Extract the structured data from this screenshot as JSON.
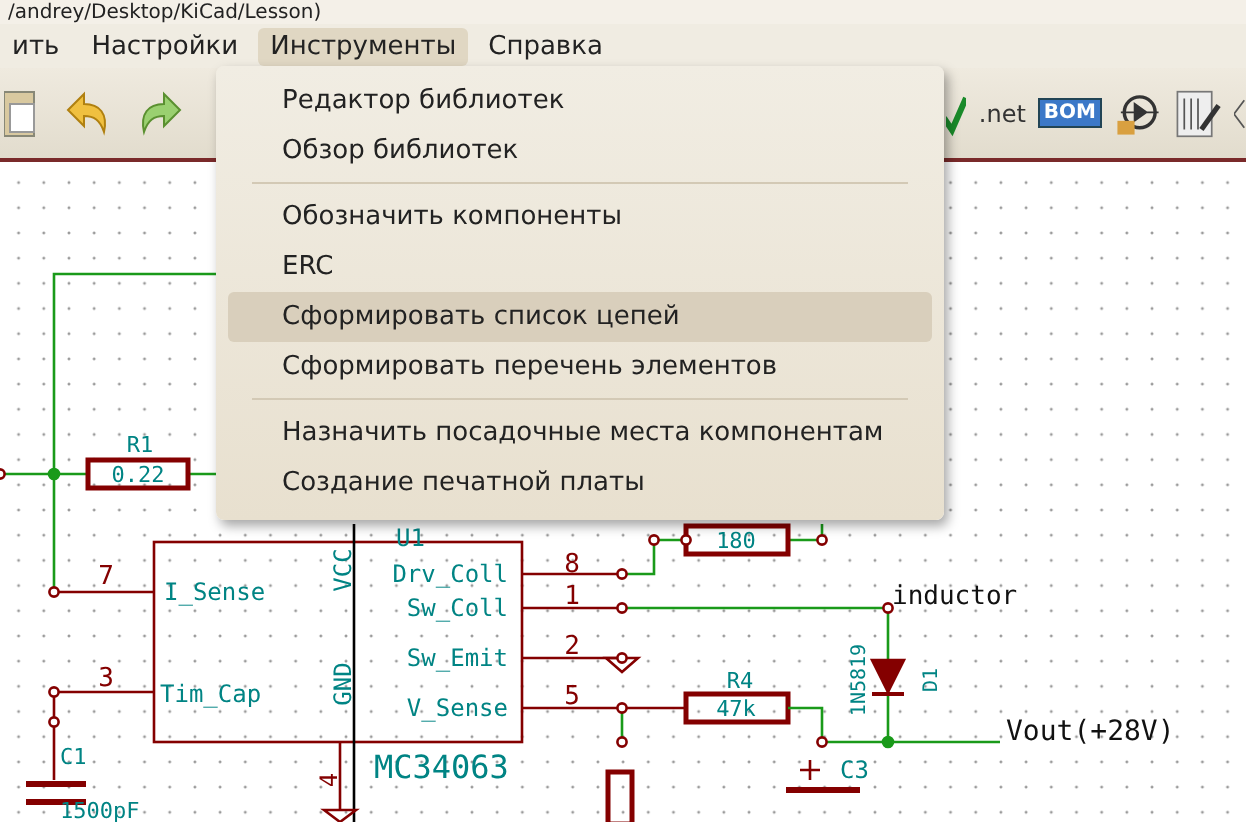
{
  "window": {
    "title": "/andrey/Desktop/KiCad/Lesson)"
  },
  "menubar": [
    {
      "label": "ить",
      "selected": false
    },
    {
      "label": "Настройки",
      "selected": false
    },
    {
      "label": "Инструменты",
      "selected": true
    },
    {
      "label": "Справка",
      "selected": false
    }
  ],
  "toolbar": {
    "netlist_label": ".net",
    "bom_label": "BOM"
  },
  "menu": {
    "items": [
      {
        "kind": "item",
        "label": "Редактор библиотек",
        "selected": false
      },
      {
        "kind": "item",
        "label": "Обзор библиотек",
        "selected": false
      },
      {
        "kind": "separator"
      },
      {
        "kind": "item",
        "label": "Обозначить компоненты",
        "selected": false
      },
      {
        "kind": "item",
        "label": "ERC",
        "selected": false
      },
      {
        "kind": "item",
        "label": "Сформировать список цепей",
        "selected": true
      },
      {
        "kind": "item",
        "label": "Сформировать перечень элементов",
        "selected": false
      },
      {
        "kind": "separator"
      },
      {
        "kind": "item",
        "label": "Назначить посадочные места компонентам",
        "selected": false
      },
      {
        "kind": "item",
        "label": "Создание печатной платы",
        "selected": false
      }
    ]
  },
  "schematic": {
    "labels": [
      {
        "kind": "reference",
        "text": "R1"
      },
      {
        "kind": "value",
        "text": "0.22"
      },
      {
        "kind": "reference",
        "text": "U1"
      },
      {
        "kind": "pin_name",
        "text": "I_Sense"
      },
      {
        "kind": "pin_name",
        "text": "Tim_Cap"
      },
      {
        "kind": "pin_name",
        "text": "VCC"
      },
      {
        "kind": "pin_name",
        "text": "GND"
      },
      {
        "kind": "pin_name",
        "text": "Drv_Coll"
      },
      {
        "kind": "pin_name",
        "text": "Sw_Coll"
      },
      {
        "kind": "pin_name",
        "text": "Sw_Emit"
      },
      {
        "kind": "pin_name",
        "text": "V_Sense"
      },
      {
        "kind": "value",
        "text": "MC34063"
      },
      {
        "kind": "pin_number",
        "text": "7"
      },
      {
        "kind": "pin_number",
        "text": "3"
      },
      {
        "kind": "pin_number",
        "text": "8"
      },
      {
        "kind": "pin_number",
        "text": "1"
      },
      {
        "kind": "pin_number",
        "text": "2"
      },
      {
        "kind": "pin_number",
        "text": "5"
      },
      {
        "kind": "pin_number",
        "text": "4"
      },
      {
        "kind": "value",
        "text": "180"
      },
      {
        "kind": "net",
        "text": "inductor"
      },
      {
        "kind": "value",
        "text": "1N5819"
      },
      {
        "kind": "reference",
        "text": "D1"
      },
      {
        "kind": "reference",
        "text": "R4"
      },
      {
        "kind": "value",
        "text": "47k"
      },
      {
        "kind": "net",
        "text": "Vout(+28V)"
      },
      {
        "kind": "reference",
        "text": "C1"
      },
      {
        "kind": "value",
        "text": "1500pF"
      },
      {
        "kind": "reference",
        "text": "C3"
      }
    ]
  }
}
